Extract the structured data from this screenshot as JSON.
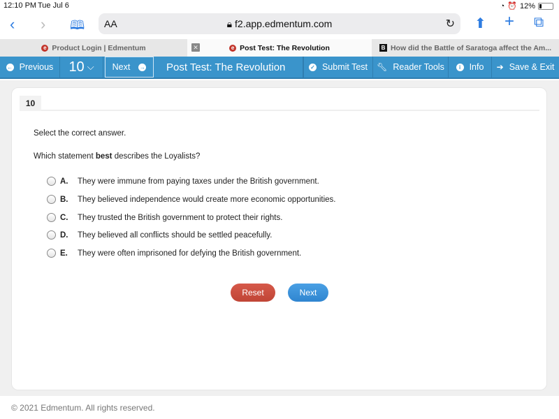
{
  "status_bar": {
    "time": "12:10 PM",
    "date": "Tue Jul 6",
    "battery": "12%"
  },
  "browser": {
    "text_size_label": "AA",
    "url": "f2.app.edmentum.com",
    "tabs": [
      {
        "label": "Product Login | Edmentum",
        "active": false
      },
      {
        "label": "Post Test: The Revolution",
        "active": true
      },
      {
        "label": "How did the Battle of Saratoga affect the Am...",
        "active": false
      }
    ]
  },
  "toolbar": {
    "previous_label": "Previous",
    "question_number": "10",
    "next_label": "Next",
    "title": "Post Test: The Revolution",
    "submit_label": "Submit Test",
    "reader_tools_label": "Reader Tools",
    "info_label": "Info",
    "save_exit_label": "Save & Exit"
  },
  "question": {
    "number": "10",
    "instruction": "Select the correct answer.",
    "prompt_before": "Which statement ",
    "prompt_bold": "best",
    "prompt_after": " describes the Loyalists?",
    "options": [
      {
        "letter": "A.",
        "text": "They were immune from paying taxes under the British government."
      },
      {
        "letter": "B.",
        "text": "They believed independence would create more economic opportunities."
      },
      {
        "letter": "C.",
        "text": "They trusted the British government to protect their rights."
      },
      {
        "letter": "D.",
        "text": "They believed all conflicts should be settled peacefully."
      },
      {
        "letter": "E.",
        "text": "They were often imprisoned for defying the British government."
      }
    ],
    "reset_label": "Reset",
    "next_label": "Next"
  },
  "footer": {
    "copyright": "© 2021 Edmentum. All rights reserved."
  },
  "colors": {
    "toolbar": "#3a94cb",
    "reset": "#c9493a",
    "next": "#3a90da"
  }
}
